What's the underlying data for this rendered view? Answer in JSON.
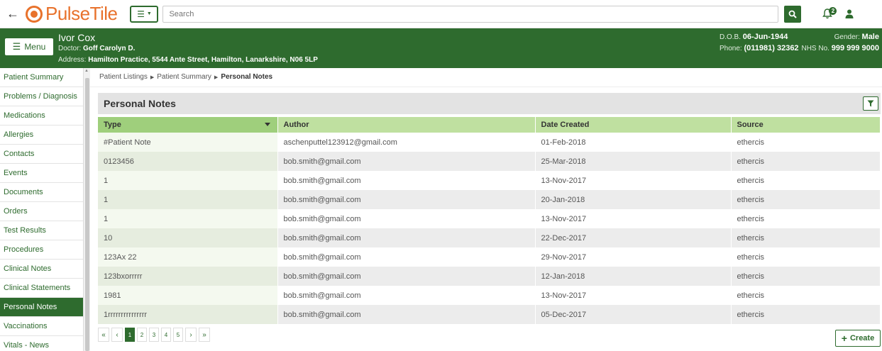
{
  "header": {
    "logo_text": "PulseTile",
    "search_placeholder": "Search",
    "notification_count": "2"
  },
  "patient": {
    "name": "Ivor Cox",
    "doctor_label": "Doctor:",
    "doctor": "Goff Carolyn D.",
    "address_label": "Address:",
    "address": "Hamilton Practice, 5544 Ante Street, Hamilton, Lanarkshire, N06 5LP",
    "dob_label": "D.O.B.",
    "dob": "06-Jun-1944",
    "phone_label": "Phone:",
    "phone": "(011981) 32362",
    "gender_label": "Gender:",
    "gender": "Male",
    "nhs_label": "NHS No.",
    "nhs": "999 999 9000"
  },
  "menu_button": "Menu",
  "sidebar": {
    "items": [
      {
        "label": "Patient Summary"
      },
      {
        "label": "Problems / Diagnosis"
      },
      {
        "label": "Medications"
      },
      {
        "label": "Allergies"
      },
      {
        "label": "Contacts"
      },
      {
        "label": "Events"
      },
      {
        "label": "Documents"
      },
      {
        "label": "Orders"
      },
      {
        "label": "Test Results"
      },
      {
        "label": "Procedures"
      },
      {
        "label": "Clinical Notes"
      },
      {
        "label": "Clinical Statements"
      },
      {
        "label": "Personal Notes"
      },
      {
        "label": "Vaccinations"
      },
      {
        "label": "Vitals - News"
      }
    ],
    "active_index": 12
  },
  "breadcrumb": {
    "items": [
      "Patient Listings",
      "Patient Summary",
      "Personal Notes"
    ]
  },
  "panel": {
    "title": "Personal Notes",
    "columns": [
      "Type",
      "Author",
      "Date Created",
      "Source"
    ],
    "rows": [
      [
        "#Patient Note",
        "aschenputtel123912@gmail.com",
        "01-Feb-2018",
        "ethercis"
      ],
      [
        "0123456",
        "bob.smith@gmail.com",
        "25-Mar-2018",
        "ethercis"
      ],
      [
        "1",
        "bob.smith@gmail.com",
        "13-Nov-2017",
        "ethercis"
      ],
      [
        "1",
        "bob.smith@gmail.com",
        "20-Jan-2018",
        "ethercis"
      ],
      [
        "1",
        "bob.smith@gmail.com",
        "13-Nov-2017",
        "ethercis"
      ],
      [
        "10",
        "bob.smith@gmail.com",
        "22-Dec-2017",
        "ethercis"
      ],
      [
        "123Ax 22",
        "bob.smith@gmail.com",
        "29-Nov-2017",
        "ethercis"
      ],
      [
        "123bxorrrrr",
        "bob.smith@gmail.com",
        "12-Jan-2018",
        "ethercis"
      ],
      [
        "1981",
        "bob.smith@gmail.com",
        "13-Nov-2017",
        "ethercis"
      ],
      [
        "1rrrrrrrrrrrrrrr",
        "bob.smith@gmail.com",
        "05-Dec-2017",
        "ethercis"
      ]
    ]
  },
  "pagination": {
    "first": "«",
    "prev": "‹",
    "pages": [
      "1",
      "2",
      "3",
      "4",
      "5"
    ],
    "next": "›",
    "last": "»",
    "active_page": "1"
  },
  "create_button": "Create",
  "colors": {
    "brand_green": "#2e6b2e",
    "logo_orange": "#e8722c",
    "header_row": "#bfe0a0"
  }
}
